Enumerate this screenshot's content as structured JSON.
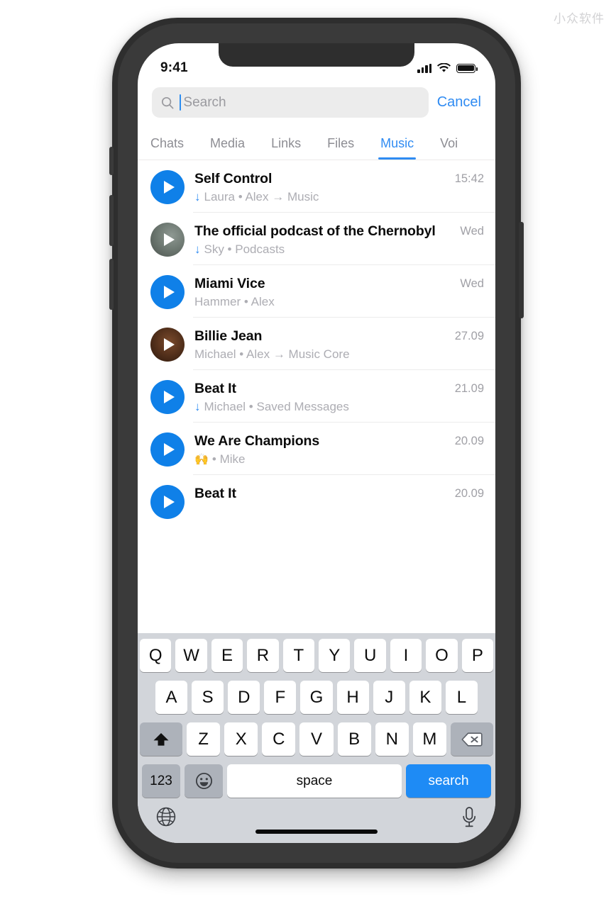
{
  "watermark": "小众软件",
  "status_bar": {
    "time": "9:41",
    "signal_icon": "signal-bars-icon",
    "wifi_icon": "wifi-icon",
    "battery_icon": "battery-full-icon"
  },
  "search": {
    "placeholder": "Search",
    "value": "",
    "icon": "search-icon",
    "cancel_label": "Cancel"
  },
  "tabs": [
    {
      "label": "Chats",
      "active": false
    },
    {
      "label": "Media",
      "active": false
    },
    {
      "label": "Links",
      "active": false
    },
    {
      "label": "Files",
      "active": false
    },
    {
      "label": "Music",
      "active": true
    },
    {
      "label": "Voi",
      "active": false
    }
  ],
  "active_tab": "Music",
  "accent_color": "#2f8bf2",
  "list": [
    {
      "title": "Self Control",
      "subtitle": "Laura • Alex → Music",
      "time": "15:42",
      "downloaded": true,
      "avatar": "play-button-blue"
    },
    {
      "title": "The official podcast of the Chernobyl",
      "subtitle": "Sky • Podcasts",
      "time": "Wed",
      "downloaded": true,
      "avatar": "play-button-photo-grey"
    },
    {
      "title": "Miami Vice",
      "subtitle": "Hammer • Alex",
      "time": "Wed",
      "downloaded": false,
      "avatar": "play-button-blue"
    },
    {
      "title": "Billie Jean",
      "subtitle": "Michael • Alex → Music Core",
      "time": "27.09",
      "downloaded": false,
      "avatar": "play-button-photo-brown"
    },
    {
      "title": "Beat It",
      "subtitle": "Michael • Saved Messages",
      "time": "21.09",
      "downloaded": true,
      "avatar": "play-button-blue"
    },
    {
      "title": "We Are Champions",
      "subtitle": "• Mike",
      "emoji": "🙌",
      "time": "20.09",
      "downloaded": false,
      "avatar": "play-button-blue"
    },
    {
      "title": "Beat It",
      "subtitle": "",
      "time": "20.09",
      "downloaded": false,
      "avatar": "play-button-blue"
    }
  ],
  "keyboard": {
    "row1": [
      "Q",
      "W",
      "E",
      "R",
      "T",
      "Y",
      "U",
      "I",
      "O",
      "P"
    ],
    "row2": [
      "A",
      "S",
      "D",
      "F",
      "G",
      "H",
      "J",
      "K",
      "L"
    ],
    "row3": [
      "Z",
      "X",
      "C",
      "V",
      "B",
      "N",
      "M"
    ],
    "shift_icon": "shift-up-arrow-icon",
    "backspace_icon": "backspace-delete-icon",
    "numbers_label": "123",
    "emoji_icon": "emoji-smiley-icon",
    "space_label": "space",
    "return_label": "search",
    "globe_icon": "globe-language-icon",
    "dictation_icon": "microphone-icon"
  }
}
